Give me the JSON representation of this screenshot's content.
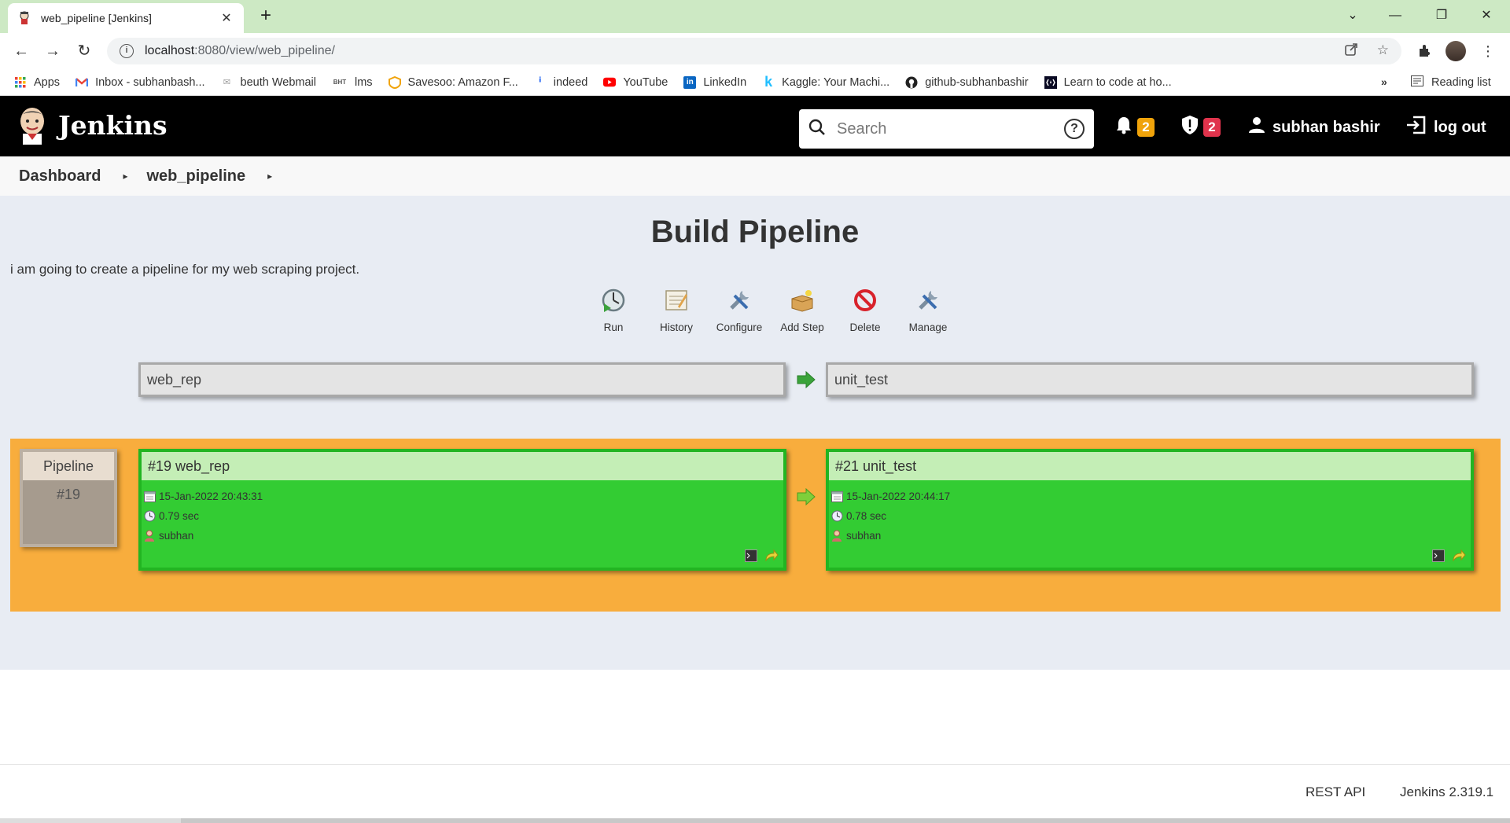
{
  "browser": {
    "tab_title": "web_pipeline [Jenkins]",
    "tab_close": "✕",
    "new_tab": "+",
    "url_host": "localhost",
    "url_path": ":8080/view/web_pipeline/",
    "window_controls": {
      "minimize": "—",
      "restore": "❐",
      "close": "✕"
    },
    "nav": {
      "back": "←",
      "forward": "→",
      "reload": "↻"
    },
    "bookmarks": [
      {
        "label": "Apps",
        "icon": "apps-grid-icon"
      },
      {
        "label": "Inbox - subhanbash...",
        "icon": "gmail-icon"
      },
      {
        "label": "beuth Webmail",
        "icon": "webmail-icon"
      },
      {
        "label": "lms",
        "icon": "bht-icon",
        "icon_text": "BHT"
      },
      {
        "label": "Savesoo: Amazon F...",
        "icon": "savesoo-icon"
      },
      {
        "label": "indeed",
        "icon": "indeed-icon"
      },
      {
        "label": "YouTube",
        "icon": "youtube-icon"
      },
      {
        "label": "LinkedIn",
        "icon": "linkedin-icon",
        "icon_text": "in"
      },
      {
        "label": "Kaggle: Your Machi...",
        "icon": "kaggle-icon",
        "icon_text": "k"
      },
      {
        "label": "github-subhanbashir",
        "icon": "github-icon"
      },
      {
        "label": "Learn to code at ho...",
        "icon": "freecodecamp-icon"
      }
    ],
    "bookmarks_more": "»",
    "reading_list": "Reading list"
  },
  "header": {
    "brand": "Jenkins",
    "search_placeholder": "Search",
    "help": "?",
    "notifications_count": "2",
    "security_count": "2",
    "user": "subhan bashir",
    "logout": "log out",
    "colors": {
      "notif_badge": "#f0a30a",
      "security_badge": "#e0334c"
    }
  },
  "breadcrumb": {
    "items": [
      "Dashboard",
      "web_pipeline"
    ],
    "separator": "▸"
  },
  "page": {
    "title": "Build Pipeline",
    "description": "i am going to create a pipeline for my web scraping project.",
    "actions": [
      {
        "label": "Run",
        "icon": "run-icon"
      },
      {
        "label": "History",
        "icon": "history-icon"
      },
      {
        "label": "Configure",
        "icon": "configure-icon"
      },
      {
        "label": "Add Step",
        "icon": "add-step-icon"
      },
      {
        "label": "Delete",
        "icon": "delete-icon"
      },
      {
        "label": "Manage",
        "icon": "manage-icon"
      }
    ]
  },
  "pipeline": {
    "jobs": [
      "web_rep",
      "unit_test"
    ],
    "row": {
      "label": "Pipeline",
      "number": "#19",
      "builds": [
        {
          "title": "#19 web_rep",
          "date": "15-Jan-2022 20:43:31",
          "duration": "0.79 sec",
          "user": "subhan",
          "status": "success"
        },
        {
          "title": "#21 unit_test",
          "date": "15-Jan-2022 20:44:17",
          "duration": "0.78 sec",
          "user": "subhan",
          "status": "success"
        }
      ]
    },
    "colors": {
      "row_bg": "#f8ad3d",
      "build_success": "#33cc33",
      "build_header": "#c4eeb6"
    }
  },
  "footer": {
    "rest_api": "REST API",
    "version": "Jenkins 2.319.1"
  }
}
